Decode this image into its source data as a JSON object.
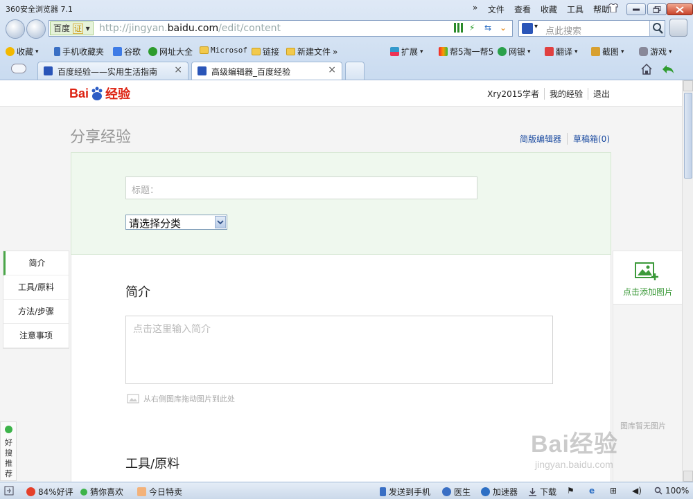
{
  "browser": {
    "app_title": "360安全浏览器 7.1",
    "menu_more": "»",
    "menu": [
      "文件",
      "查看",
      "收藏",
      "工具",
      "帮助"
    ],
    "address": {
      "chip_label": "百度",
      "chip_badge": "证",
      "url_prefix": "http://jingyan.",
      "url_host": "baidu.com",
      "url_path": "/edit/content"
    },
    "search": {
      "placeholder": "点此搜索"
    },
    "favorites": [
      "收藏",
      "手机收藏夹",
      "谷歌",
      "网址大全",
      "Microsof",
      "链接",
      "新建文件"
    ],
    "favorites_more": "»",
    "toolbar_right": [
      "扩展",
      "帮5淘一帮5",
      "网银",
      "翻译",
      "截图",
      "游戏"
    ],
    "tabs": [
      {
        "label": "百度经验——实用生活指南",
        "close": "×"
      },
      {
        "label": "高级编辑器_百度经验",
        "close": "×"
      }
    ]
  },
  "page": {
    "logo": {
      "bai": "Bai",
      "du": "du",
      "jingyan": "经验"
    },
    "user_links": [
      "Xry2015学者",
      "我的经验",
      "退出"
    ],
    "title": "分享经验",
    "editor_links": [
      "简版编辑器",
      "草稿箱(0)"
    ],
    "form": {
      "title_placeholder": "标题：",
      "category_selected": "请选择分类"
    },
    "side_nav": [
      "简介",
      "工具/原料",
      "方法/步骤",
      "注意事项"
    ],
    "sections": {
      "intro_heading": "简介",
      "intro_placeholder": "点击这里输入简介",
      "drag_hint": "从右侧图库拖动图片到此处",
      "tools_heading": "工具/原料"
    },
    "right_panel": {
      "add_image": "点击添加图片",
      "empty": "图库暂无图片"
    },
    "haosou": "好搜推荐",
    "watermark": {
      "big": "Bai经验",
      "small": "jingyan.baidu.com"
    }
  },
  "statusbar": {
    "rating": "84%好评",
    "guess": "猜你喜欢",
    "today": "今日特卖",
    "send_phone": "发送到手机",
    "doctor": "医生",
    "accelerator": "加速器",
    "download": "下载",
    "zoom": "100%"
  },
  "colors": {
    "accent_green": "#3c9a3a",
    "link_blue": "#1a4aa0",
    "brand_red": "#d21"
  }
}
